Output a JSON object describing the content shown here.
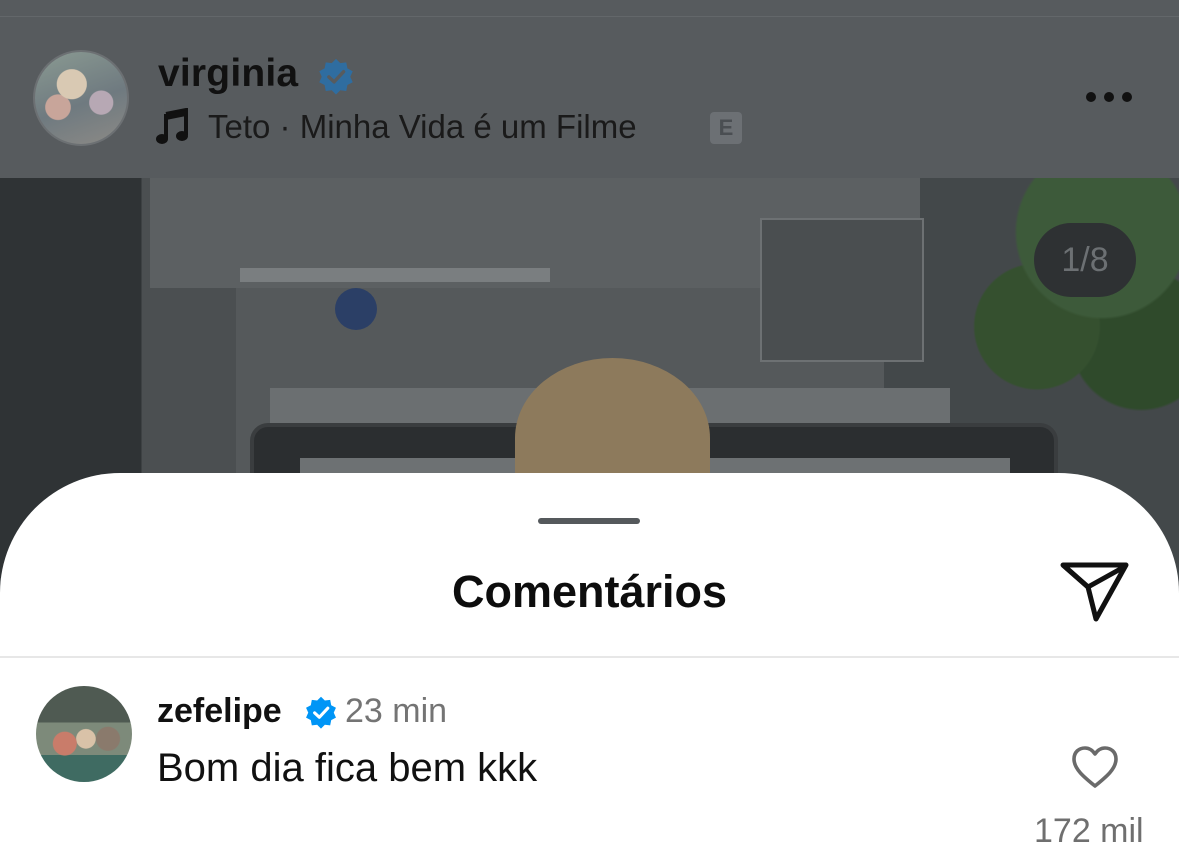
{
  "post_header": {
    "username": "virginia",
    "music_artist": "Teto",
    "music_separator": "·",
    "music_title": "Minha Vida é um Filme",
    "explicit_badge": "E"
  },
  "media": {
    "counter": "1/8"
  },
  "comments_sheet": {
    "title": "Comentários"
  },
  "comments": [
    {
      "username": "zefelipe",
      "time": "23 min",
      "text": "Bom dia fica bem kkk",
      "likes": "172 mil"
    }
  ],
  "icons": {
    "verified": "verified-badge-icon",
    "music": "music-note-icon",
    "more": "more-options-icon",
    "send": "send-icon",
    "heart": "heart-icon"
  },
  "colors": {
    "verified_blue": "#0095f6",
    "overlay_header": "#575b5e",
    "sheet_background": "#ffffff"
  }
}
